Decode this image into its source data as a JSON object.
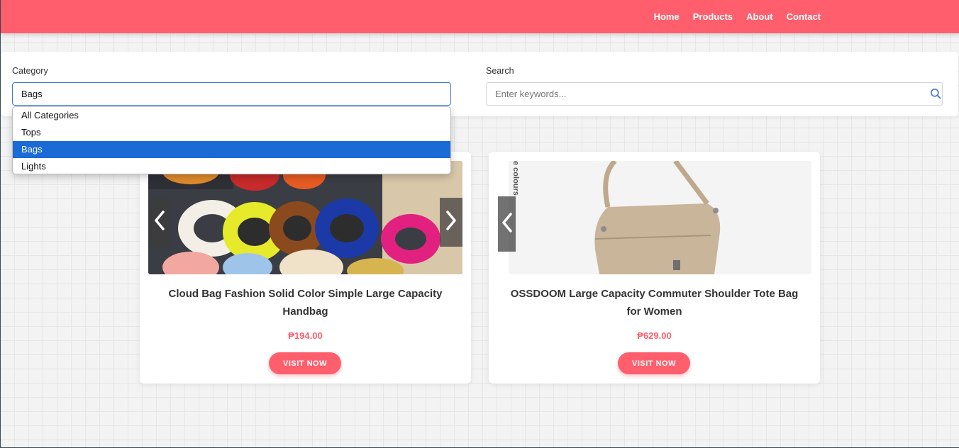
{
  "nav": {
    "links": [
      "Home",
      "Products",
      "About",
      "Contact"
    ]
  },
  "filters": {
    "category_label": "Category",
    "category_value": "Bags",
    "category_options": [
      "All Categories",
      "Tops",
      "Bags",
      "Lights"
    ],
    "selected_option": "Bags",
    "search_label": "Search",
    "search_placeholder": "Enter keywords...",
    "search_value": "",
    "search_icon": "search-icon"
  },
  "products": [
    {
      "title": "Cloud Bag Fashion Solid Color Simple Large Capacity Handbag",
      "price": "₱194.00",
      "button": "VISIT NOW",
      "image_text": ""
    },
    {
      "title": "OSSDOOM Large Capacity Commuter Shoulder Tote Bag for Women",
      "price": "₱629.00",
      "button": "VISIT NOW",
      "image_text": "e colours"
    }
  ],
  "colors": {
    "brand": "#ff5f6d",
    "select_highlight": "#1a6bd6"
  }
}
